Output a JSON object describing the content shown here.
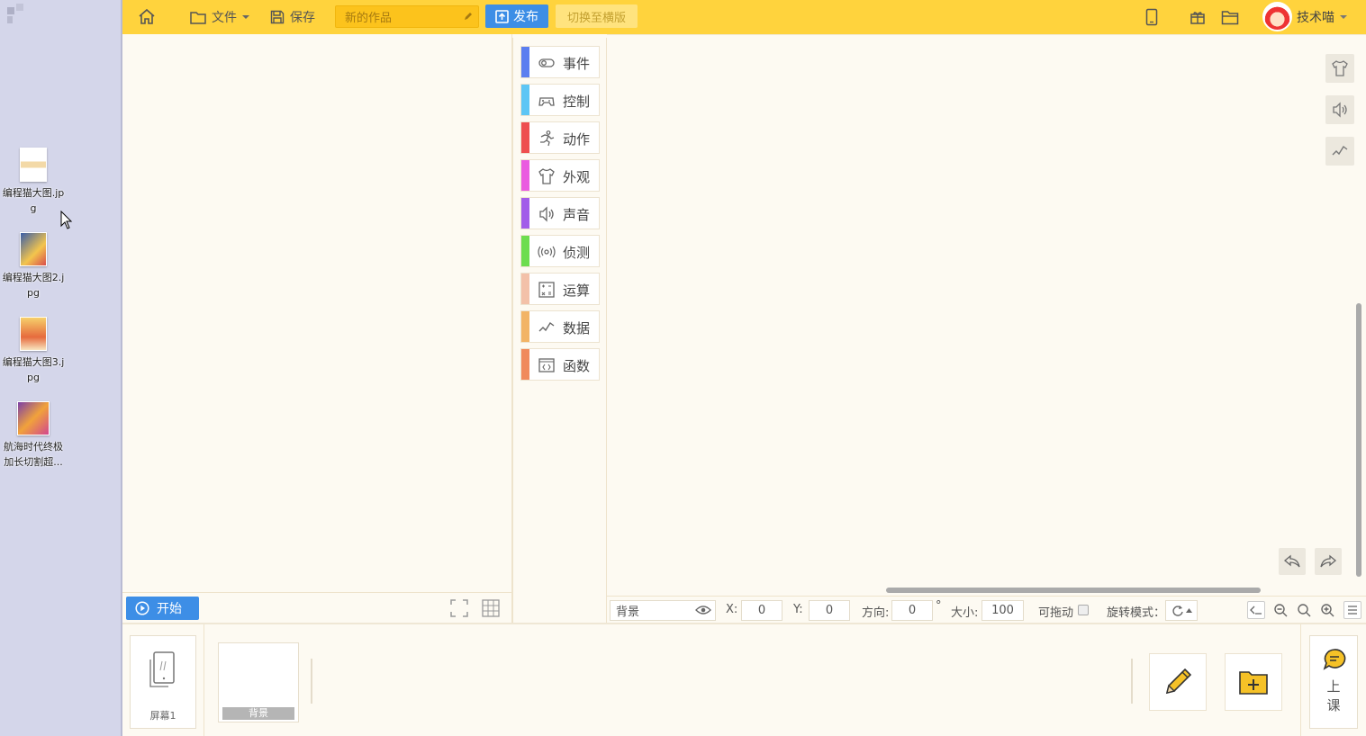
{
  "desktop": {
    "icons": [
      {
        "label": "编程猫大图.jpg",
        "thumb_color": "#f6e8d0"
      },
      {
        "label": "编程猫大图2.jpg",
        "thumb_color": "#4a6fb0"
      },
      {
        "label": "编程猫大图3.jpg",
        "thumb_color": "#e8a24a"
      },
      {
        "label": "航海时代终极加长切割超...",
        "thumb_color": "#c95aa8"
      }
    ]
  },
  "topbar": {
    "file_label": "文件",
    "save_label": "保存",
    "title_value": "新的作品",
    "publish_label": "发布",
    "landscape_label": "切换至横版",
    "username": "技术喵",
    "accent": "#ffd33d",
    "blue": "#3d8ee6"
  },
  "categories": [
    {
      "label": "事件",
      "color": "#5b7ef0",
      "icon": "toggle-icon"
    },
    {
      "label": "控制",
      "color": "#5ec6f5",
      "icon": "gamepad-icon"
    },
    {
      "label": "动作",
      "color": "#ee4f4f",
      "icon": "runner-icon"
    },
    {
      "label": "外观",
      "color": "#ea5be0",
      "icon": "shirt-icon"
    },
    {
      "label": "声音",
      "color": "#a25ce9",
      "icon": "speaker-icon"
    },
    {
      "label": "侦测",
      "color": "#6ddd4f",
      "icon": "radar-icon"
    },
    {
      "label": "运算",
      "color": "#f3c1a9",
      "icon": "calculator-icon"
    },
    {
      "label": "数据",
      "color": "#f2b466",
      "icon": "chart-icon"
    },
    {
      "label": "函数",
      "color": "#f08a5c",
      "icon": "code-icon"
    }
  ],
  "stage": {
    "start_label": "开始"
  },
  "props": {
    "sprite_name": "背景",
    "x_label": "X:",
    "x_value": "0",
    "y_label": "Y:",
    "y_value": "0",
    "direction_label": "方向:",
    "direction_value": "0",
    "degree": "°",
    "size_label": "大小:",
    "size_value": "100",
    "draggable_label": "可拖动",
    "rotation_label": "旋转模式："
  },
  "bottom": {
    "screen_label": "屏幕1",
    "background_label": "背景",
    "class_label": "上课"
  }
}
